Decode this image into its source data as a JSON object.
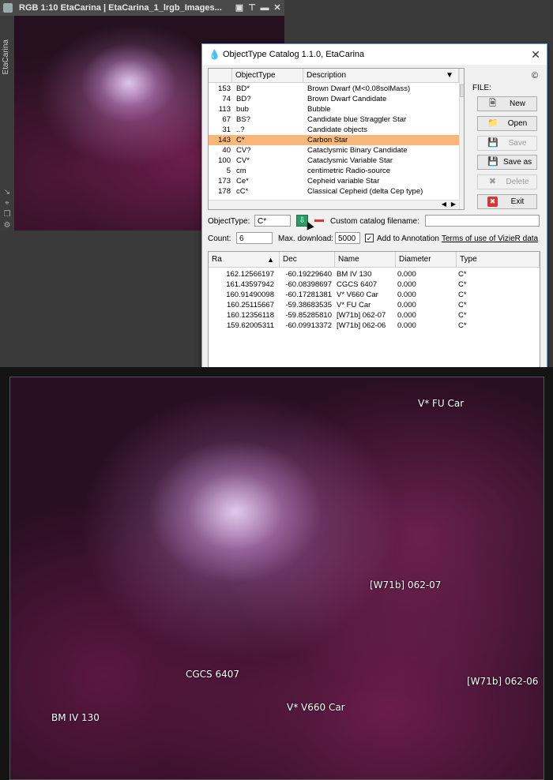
{
  "image_window": {
    "title": "RGB 1:10 EtaCarina | EtaCarina_1_lrgb_Images...",
    "side_tab": "EtaCarina"
  },
  "dialog": {
    "title": "ObjectType Catalog 1.1.0, EtaCarina",
    "copyright": "©",
    "file_label": "FILE:",
    "buttons": {
      "new": "New",
      "open": "Open",
      "save": "Save",
      "save_as": "Save as",
      "delete": "Delete",
      "exit": "Exit"
    },
    "types_table": {
      "headers": [
        "",
        "ObjectType",
        "Description"
      ],
      "rows": [
        [
          "153",
          "BD*",
          "Brown Dwarf (M<0.08solMass)"
        ],
        [
          "74",
          "BD?",
          "Brown Dwarf Candidate"
        ],
        [
          "113",
          "bub",
          "Bubble"
        ],
        [
          "67",
          "BS?",
          "Candidate blue Straggler Star"
        ],
        [
          "31",
          "..?",
          "Candidate objects"
        ],
        [
          "143",
          "C*",
          "Carbon Star"
        ],
        [
          "40",
          "CV?",
          "Cataclysmic Binary Candidate"
        ],
        [
          "100",
          "CV*",
          "Cataclysmic Variable Star"
        ],
        [
          "5",
          "cm",
          "centimetric Radio-source"
        ],
        [
          "173",
          "Ce*",
          "Cepheid variable Star"
        ],
        [
          "178",
          "cC*",
          "Classical Cepheid (delta Cep type)"
        ]
      ],
      "selected_index": 5
    },
    "object_type_label": "ObjectType:",
    "object_type_value": "C*",
    "custom_catalog_label": "Custom catalog filename:",
    "custom_catalog_value": "",
    "count_label": "Count:",
    "count_value": "6",
    "max_download_label": "Max. download:",
    "max_download_value": "5000",
    "add_to_annotation_label": "Add to Annotation",
    "add_to_annotation_checked": true,
    "terms_link": "Terms of use of VizieR data",
    "results_table": {
      "headers": [
        "Ra",
        "Dec",
        "Name",
        "Diameter",
        "Type"
      ],
      "rows": [
        [
          "162.12566197",
          "-60.19229640",
          "BM   IV 130",
          "0.000",
          "C*"
        ],
        [
          "161.43597942",
          "-60.08398697",
          "CGCS 6407",
          "0.000",
          "C*"
        ],
        [
          "160.91490098",
          "-60.17281381",
          "V* V660 Car",
          "0.000",
          "C*"
        ],
        [
          "160.25115667",
          "-59.38683535",
          "V* FU Car",
          "0.000",
          "C*"
        ],
        [
          "160.12356118",
          "-59.85285810",
          "[W71b] 062-07",
          "0.000",
          "C*"
        ],
        [
          "159.62005311",
          "-60.09913372",
          "[W71b] 062-06",
          "0.000",
          "C*"
        ]
      ]
    }
  },
  "annotations": [
    {
      "label": "V* FU Car"
    },
    {
      "label": "[W71b] 062-07"
    },
    {
      "label": "CGCS 6407"
    },
    {
      "label": "[W71b] 062-06"
    },
    {
      "label": "V* V660 Car"
    },
    {
      "label": "BM IV 130"
    }
  ],
  "icons": {
    "titlebar_buttons": [
      "restore-icon",
      "pin-icon",
      "minimize-icon",
      "close-icon"
    ],
    "dialog_icon": "app-drop-icon"
  },
  "colors": {
    "selected_row": "#f7b77a",
    "download_button": "#2a9c6a",
    "remove_button": "#dd3333"
  }
}
